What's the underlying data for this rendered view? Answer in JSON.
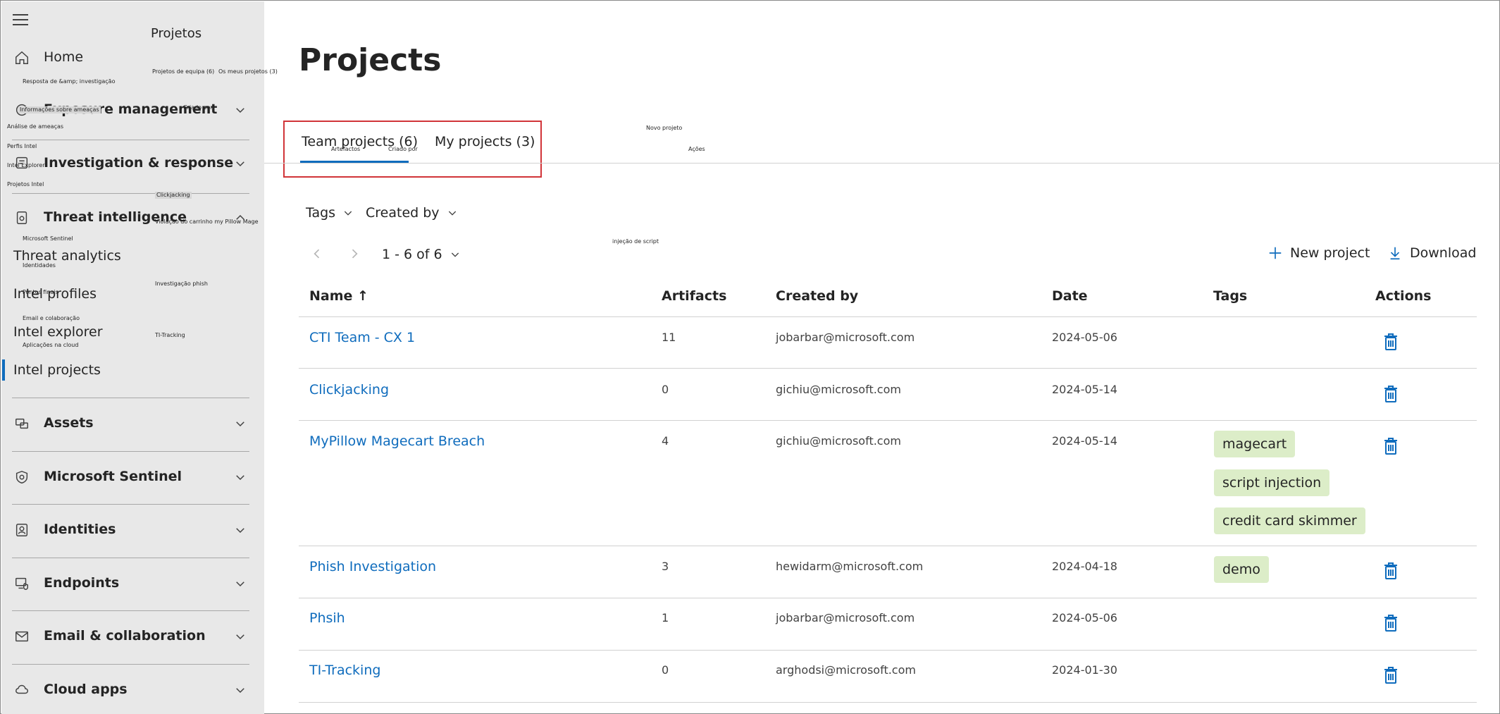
{
  "sidebar": {
    "header_title": "Projetos",
    "items": [
      {
        "id": "home",
        "label": "Home",
        "icon": "home-icon"
      },
      {
        "id": "exposure",
        "label": "Exposure management",
        "icon": "exposure-icon"
      },
      {
        "id": "investigation",
        "label": "Investigation & response",
        "icon": "investigation-icon"
      },
      {
        "id": "threat-intel",
        "label": "Threat intelligence",
        "icon": "threat-intel-icon"
      },
      {
        "id": "assets",
        "label": "Assets",
        "icon": "assets-icon"
      },
      {
        "id": "sentinel",
        "label": "Microsoft Sentinel",
        "icon": "sentinel-icon"
      },
      {
        "id": "identities",
        "label": "Identities",
        "icon": "identities-icon"
      },
      {
        "id": "endpoints",
        "label": "Endpoints",
        "icon": "endpoints-icon"
      },
      {
        "id": "email",
        "label": "Email & collaboration",
        "icon": "email-icon"
      },
      {
        "id": "cloud",
        "label": "Cloud apps",
        "icon": "cloud-icon"
      }
    ],
    "threat_intel_sub": [
      "Threat analytics",
      "Intel profiles",
      "Intel explorer",
      "Intel projects"
    ],
    "overlay_labels": {
      "resp_invest": "Resposta de &amp; investigação",
      "info_ameacas": "Informações sobre ameaças",
      "analise_ameacas": "Análise de ameaças",
      "perfis_intel": "Perfis Intel",
      "intel_explorer": "Intel Explorer",
      "projetos_intel": "Projetos Intel",
      "ms_sentinel": "Microsoft Sentinel",
      "identidades": "Identidades",
      "pontos_finais": "Pontos finais",
      "email_colab": "Email e colaboração",
      "apps_cloud": "Aplicações na cloud",
      "projetos_equipa": "Projetos de equipa (6)",
      "meus_projetos": "Os meus projetos (3)",
      "criado_por_1": "Criado por",
      "clickjacking": "Clickjacking",
      "violacao": "Violação do carrinho my Pillow Mage",
      "invest_phish": "Investigação phish",
      "ti_tracking": "TI-Tracking"
    }
  },
  "main": {
    "title": "Projects",
    "tabs": [
      {
        "label": "Team projects (6)",
        "active": true
      },
      {
        "label": "My projects (3)",
        "active": false
      }
    ],
    "overlay_labels": {
      "artefactos": "Artefactos",
      "criado_por": "Criado por",
      "novo_projeto": "Novo projeto",
      "acoes": "Ações",
      "injecao": "injeção de script"
    },
    "filters": {
      "tags": "Tags",
      "created_by": "Created by"
    },
    "pager": {
      "text": "1 - 6 of 6"
    },
    "commands": {
      "new_project": "New project",
      "download": "Download"
    },
    "columns": {
      "name": "Name ↑",
      "artifacts": "Artifacts",
      "created_by": "Created by",
      "date": "Date",
      "tags": "Tags",
      "actions": "Actions"
    },
    "rows": [
      {
        "name": "CTI Team - CX 1",
        "artifacts": "11",
        "created_by": "jobarbar@microsoft.com",
        "date": "2024-05-06",
        "tags": []
      },
      {
        "name": "Clickjacking",
        "artifacts": "0",
        "created_by": "gichiu@microsoft.com",
        "date": "2024-05-14",
        "tags": []
      },
      {
        "name": "MyPillow Magecart Breach",
        "artifacts": "4",
        "created_by": "gichiu@microsoft.com",
        "date": "2024-05-14",
        "tags": [
          "magecart",
          "script injection",
          "credit card skimmer"
        ]
      },
      {
        "name": "Phish Investigation",
        "artifacts": "3",
        "created_by": "hewidarm@microsoft.com",
        "date": "2024-04-18",
        "tags": [
          "demo"
        ]
      },
      {
        "name": "Phsih",
        "artifacts": "1",
        "created_by": "jobarbar@microsoft.com",
        "date": "2024-05-06",
        "tags": []
      },
      {
        "name": "TI-Tracking",
        "artifacts": "0",
        "created_by": "arghodsi@microsoft.com",
        "date": "2024-01-30",
        "tags": []
      }
    ]
  },
  "colors": {
    "accent": "#0f6cbd",
    "highlight": "#d13438",
    "tag_bg": "#dcedc8",
    "sidebar_bg": "#e8e8e8"
  }
}
